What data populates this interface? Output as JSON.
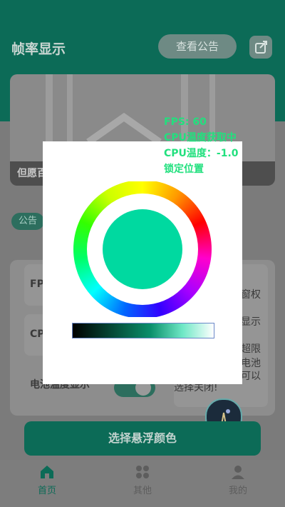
{
  "app": {
    "title": "帧率显示",
    "notice_button": "查看公告",
    "share_icon": "share-icon"
  },
  "banner": {
    "caption": "但愿百"
  },
  "notice_tag": "公告",
  "features": {
    "fps_label": "FPS",
    "cpu_label": "CPU",
    "battery_label": "电池温度显示",
    "side_lines": [
      "窗权",
      "显示",
      "超限",
      "电池",
      "可以"
    ],
    "side_bottom": "选择关闭!"
  },
  "primary_button": "选择悬浮颜色",
  "bottom_nav": [
    {
      "label": "首页",
      "icon": "home-icon",
      "active": true
    },
    {
      "label": "其他",
      "icon": "grid-icon",
      "active": false
    },
    {
      "label": "我的",
      "icon": "user-icon",
      "active": false
    }
  ],
  "overlay": {
    "fps": "FPS: 60",
    "cpu_status": "CPU温度获取中",
    "cpu_temp": "CPU温度：-1.0",
    "lock": "锁定位置"
  },
  "colors": {
    "brand": "#0c6b57",
    "selected": "#00d9a0",
    "overlay_text": "#22e07e"
  }
}
